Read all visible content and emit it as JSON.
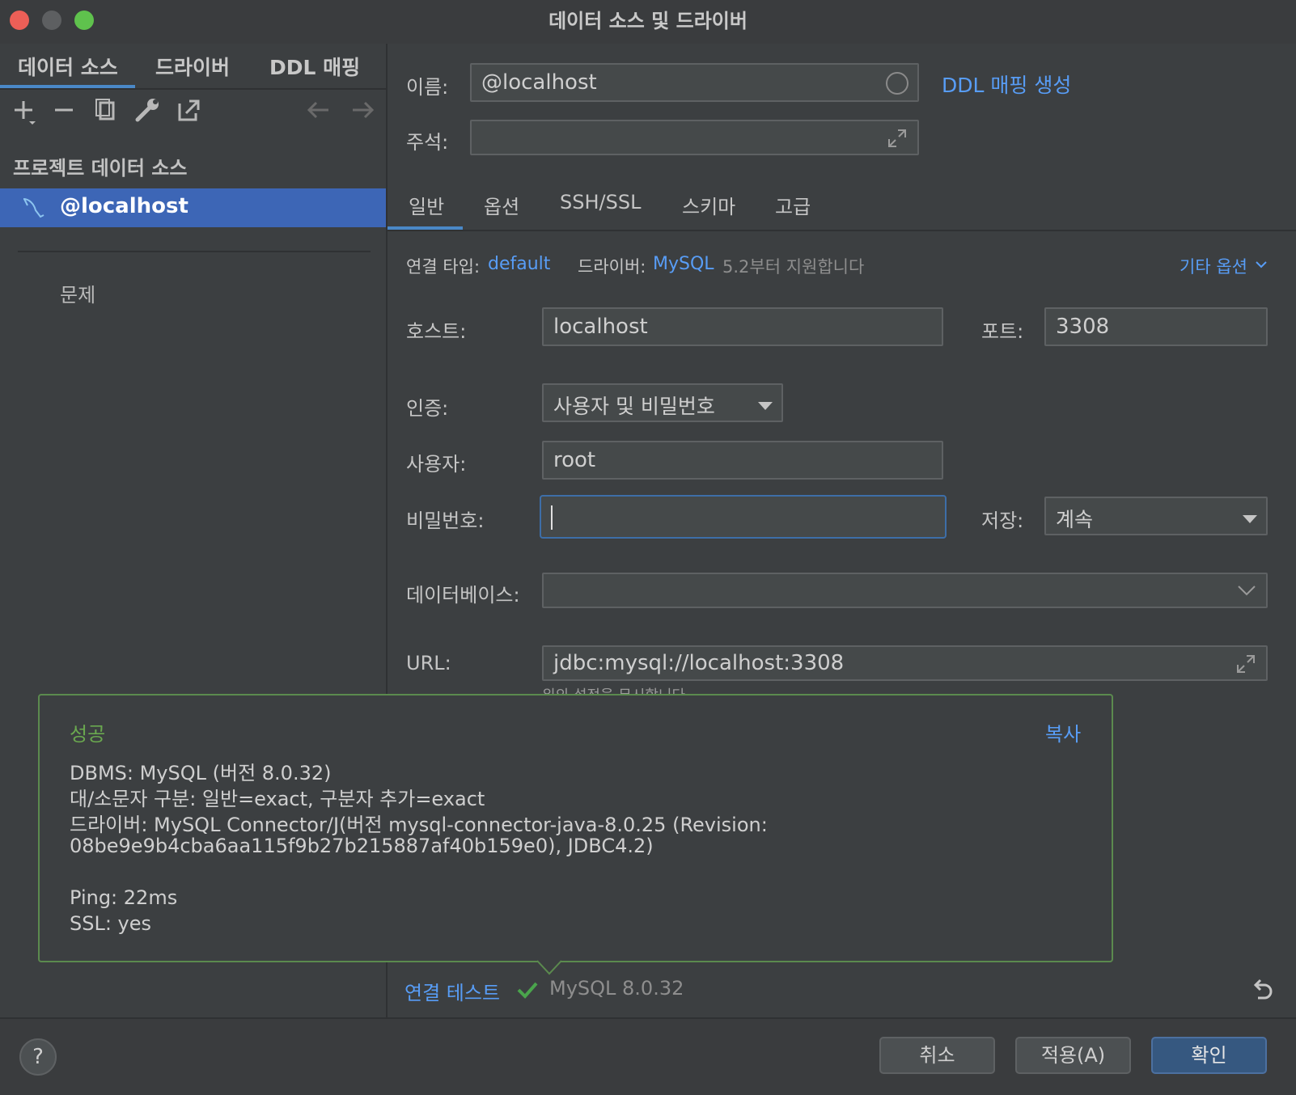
{
  "window": {
    "title": "데이터 소스 및 드라이버"
  },
  "sidebar": {
    "tabs": [
      "데이터 소스",
      "드라이버",
      "DDL 매핑"
    ],
    "section_title": "프로젝트 데이터 소스",
    "selected_item": "@localhost",
    "problems_label": "문제"
  },
  "header": {
    "name_label": "이름:",
    "name_value": "@localhost",
    "comment_label": "주석:",
    "ddl_link": "DDL 매핑 생성"
  },
  "tabs": [
    "일반",
    "옵션",
    "SSH/SSL",
    "스키마",
    "고급"
  ],
  "conn": {
    "type_label": "연결 타입:",
    "type_value": "default",
    "driver_label": "드라이버:",
    "driver_value": "MySQL",
    "driver_note": "5.2부터 지원합니다",
    "more_options": "기타 옵션"
  },
  "form": {
    "host_label": "호스트:",
    "host_value": "localhost",
    "port_label": "포트:",
    "port_value": "3308",
    "auth_label": "인증:",
    "auth_value": "사용자 및 비밀번호",
    "user_label": "사용자:",
    "user_value": "root",
    "password_label": "비밀번호:",
    "password_value": "",
    "save_label": "저장:",
    "save_value": "계속",
    "db_label": "데이터베이스:",
    "db_value": "",
    "url_label": "URL:",
    "url_value": "jdbc:mysql://localhost:3308",
    "url_note": "위의 설정을 무시합니다"
  },
  "popup": {
    "title": "성공",
    "copy": "복사",
    "lines": [
      "DBMS: MySQL (버전 8.0.32)",
      "대/소문자 구분: 일반=exact, 구분자 추가=exact",
      "드라이버: MySQL Connector/J(버전 mysql-connector-java-8.0.25 (Revision:",
      "08be9e9b4cba6aa115f9b27b215887af40b159e0), JDBC4.2)",
      "Ping: 22ms",
      "SSL: yes"
    ]
  },
  "status": {
    "test_link": "연결 테스트",
    "result": "MySQL 8.0.32"
  },
  "buttons": {
    "help": "?",
    "cancel": "취소",
    "apply": "적용(A)",
    "ok": "확인"
  },
  "colors": {
    "accent": "#589df6",
    "selection": "#3d66b6",
    "success": "#5b8a4e",
    "check": "#4aa44c"
  }
}
